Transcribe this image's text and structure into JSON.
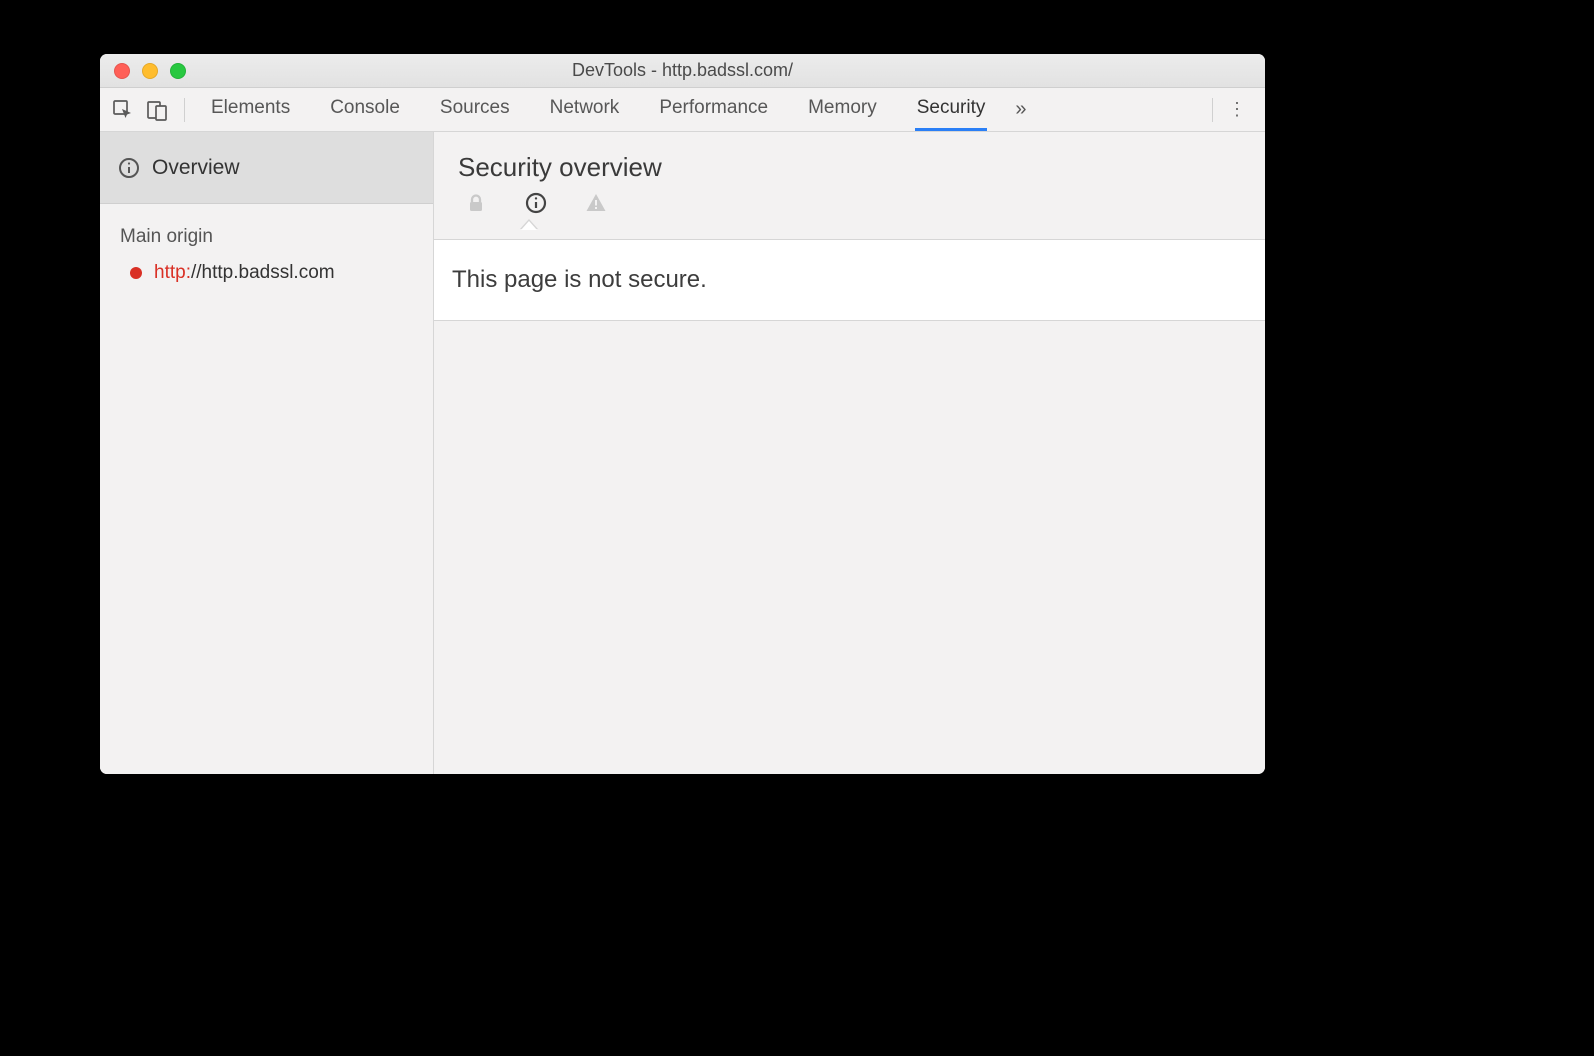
{
  "window": {
    "title": "DevTools - http.badssl.com/"
  },
  "toolbar": {
    "tabs": [
      {
        "label": "Elements",
        "active": false
      },
      {
        "label": "Console",
        "active": false
      },
      {
        "label": "Sources",
        "active": false
      },
      {
        "label": "Network",
        "active": false
      },
      {
        "label": "Performance",
        "active": false
      },
      {
        "label": "Memory",
        "active": false
      },
      {
        "label": "Security",
        "active": true
      }
    ],
    "overflow_glyph": "»",
    "menu_glyph": "⋮"
  },
  "sidebar": {
    "overview_label": "Overview",
    "section_label": "Main origin",
    "origins": [
      {
        "scheme": "http:",
        "rest": "//http.badssl.com",
        "status": "insecure"
      }
    ]
  },
  "main": {
    "title": "Security overview",
    "message": "This page is not secure.",
    "active_status": "info"
  }
}
